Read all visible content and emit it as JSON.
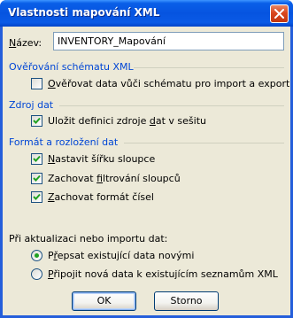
{
  "window": {
    "title": "Vlastnosti mapování XML"
  },
  "name": {
    "label_prefix": "N",
    "label_rest": "ázev:",
    "value": "INVENTORY_Mapování"
  },
  "schema_validation": {
    "heading": "Ověřování schématu XML",
    "validate_checkbox": {
      "label_prefix": "",
      "label_ul": "O",
      "label_rest": "věřovat data vůči schématu pro import a export",
      "checked": false
    }
  },
  "data_source": {
    "heading": "Zdroj dat",
    "save_checkbox": {
      "label_prefix": "Uložit definici zdroje ",
      "label_ul": "d",
      "label_rest": "at v sešitu",
      "checked": true
    }
  },
  "format_layout": {
    "heading": "Formát a rozložení dat",
    "column_width": {
      "label_prefix": "",
      "label_ul": "N",
      "label_rest": "astavit šířku sloupce",
      "checked": true
    },
    "keep_filter": {
      "label_prefix": "Zachovat ",
      "label_ul": "f",
      "label_rest": "iltrování sloupců",
      "checked": true
    },
    "keep_number_format": {
      "label_prefix": "",
      "label_ul": "Z",
      "label_rest": "achovat formát čísel",
      "checked": true
    }
  },
  "refresh": {
    "heading": "Při aktualizaci nebo importu dat:",
    "overwrite_radio": {
      "label_prefix": "P",
      "label_ul": "ř",
      "label_rest": "epsat existující data novými",
      "selected": true
    },
    "append_radio": {
      "label_prefix": "",
      "label_ul": "P",
      "label_rest": "řipojit nová data k existujícím seznamům XML",
      "selected": false
    }
  },
  "buttons": {
    "ok_label": "OK",
    "cancel_label": "Storno"
  },
  "colors": {
    "title_bar": "#0654e0",
    "section_heading": "#0046d5",
    "dialog_face": "#ece9d8",
    "check_mark": "#21a121"
  }
}
